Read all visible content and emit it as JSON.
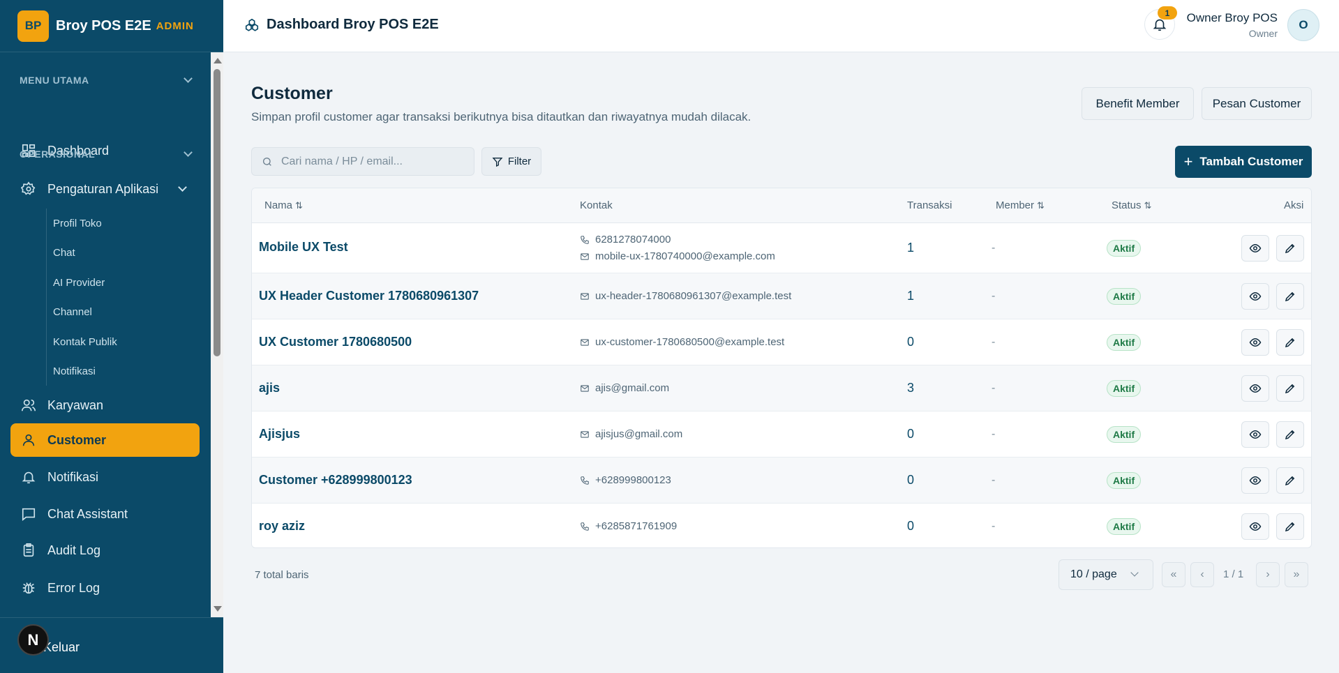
{
  "brand": {
    "logo": "BP",
    "name": "Broy POS E2E",
    "tag": "ADMIN"
  },
  "sidebar": {
    "sections": [
      {
        "label": "MENU UTAMA"
      },
      {
        "label": "OPERASIONAL"
      }
    ],
    "items": [
      {
        "label": "Dashboard",
        "icon": "dashboard-icon"
      },
      {
        "label": "Pengaturan Aplikasi",
        "icon": "gear-icon"
      },
      {
        "label": "Karyawan",
        "icon": "users-icon"
      },
      {
        "label": "Customer",
        "icon": "user-icon",
        "active": true
      },
      {
        "label": "Notifikasi",
        "icon": "bell-icon"
      },
      {
        "label": "Chat Assistant",
        "icon": "chat-icon"
      },
      {
        "label": "Audit Log",
        "icon": "clipboard-icon"
      },
      {
        "label": "Error Log",
        "icon": "bug-icon"
      }
    ],
    "sub_items": [
      "Profil Toko",
      "Chat",
      "AI Provider",
      "Channel",
      "Kontak Publik",
      "Notifikasi"
    ],
    "logout": "Keluar",
    "next_badge": "N"
  },
  "topbar": {
    "title": "Dashboard Broy POS E2E",
    "notif_count": "1",
    "user_name": "Owner Broy POS",
    "user_role": "Owner",
    "avatar": "O"
  },
  "page": {
    "title": "Customer",
    "subtitle": "Simpan profil customer agar transaksi berikutnya bisa ditautkan dan riwayatnya mudah dilacak.",
    "benefit_button": "Benefit Member",
    "message_button": "Pesan Customer",
    "search_placeholder": "Cari nama / HP / email...",
    "filter_label": "Filter",
    "add_button": "Tambah Customer"
  },
  "table": {
    "headers": {
      "nama": "Nama",
      "kontak": "Kontak",
      "transaksi": "Transaksi",
      "member": "Member",
      "status": "Status",
      "aksi": "Aksi"
    },
    "sort_icon": "⇅",
    "rows": [
      {
        "name": "Mobile UX Test",
        "phone": "6281278074000",
        "email": "mobile-ux-1780740000@example.com",
        "transaksi": "1",
        "member": "-",
        "status": "Aktif"
      },
      {
        "name": "UX Header Customer 1780680961307",
        "phone": "",
        "email": "ux-header-1780680961307@example.test",
        "transaksi": "1",
        "member": "-",
        "status": "Aktif"
      },
      {
        "name": "UX Customer 1780680500",
        "phone": "",
        "email": "ux-customer-1780680500@example.test",
        "transaksi": "0",
        "member": "-",
        "status": "Aktif"
      },
      {
        "name": "ajis",
        "phone": "",
        "email": "ajis@gmail.com",
        "transaksi": "3",
        "member": "-",
        "status": "Aktif"
      },
      {
        "name": "Ajisjus",
        "phone": "",
        "email": "ajisjus@gmail.com",
        "transaksi": "0",
        "member": "-",
        "status": "Aktif"
      },
      {
        "name": "Customer +628999800123",
        "phone": "+628999800123",
        "email": "",
        "transaksi": "0",
        "member": "-",
        "status": "Aktif"
      },
      {
        "name": "roy aziz",
        "phone": "+6285871761909",
        "email": "",
        "transaksi": "0",
        "member": "-",
        "status": "Aktif"
      }
    ]
  },
  "pagination": {
    "total": "7 total baris",
    "per_page": "10 / page",
    "page_info": "1 / 1",
    "first": "«",
    "prev": "‹",
    "next": "›",
    "last": "»"
  },
  "colors": {
    "sidebar": "#0b4a68",
    "accent": "#f2a30f",
    "status_green": "#1e7a46"
  }
}
